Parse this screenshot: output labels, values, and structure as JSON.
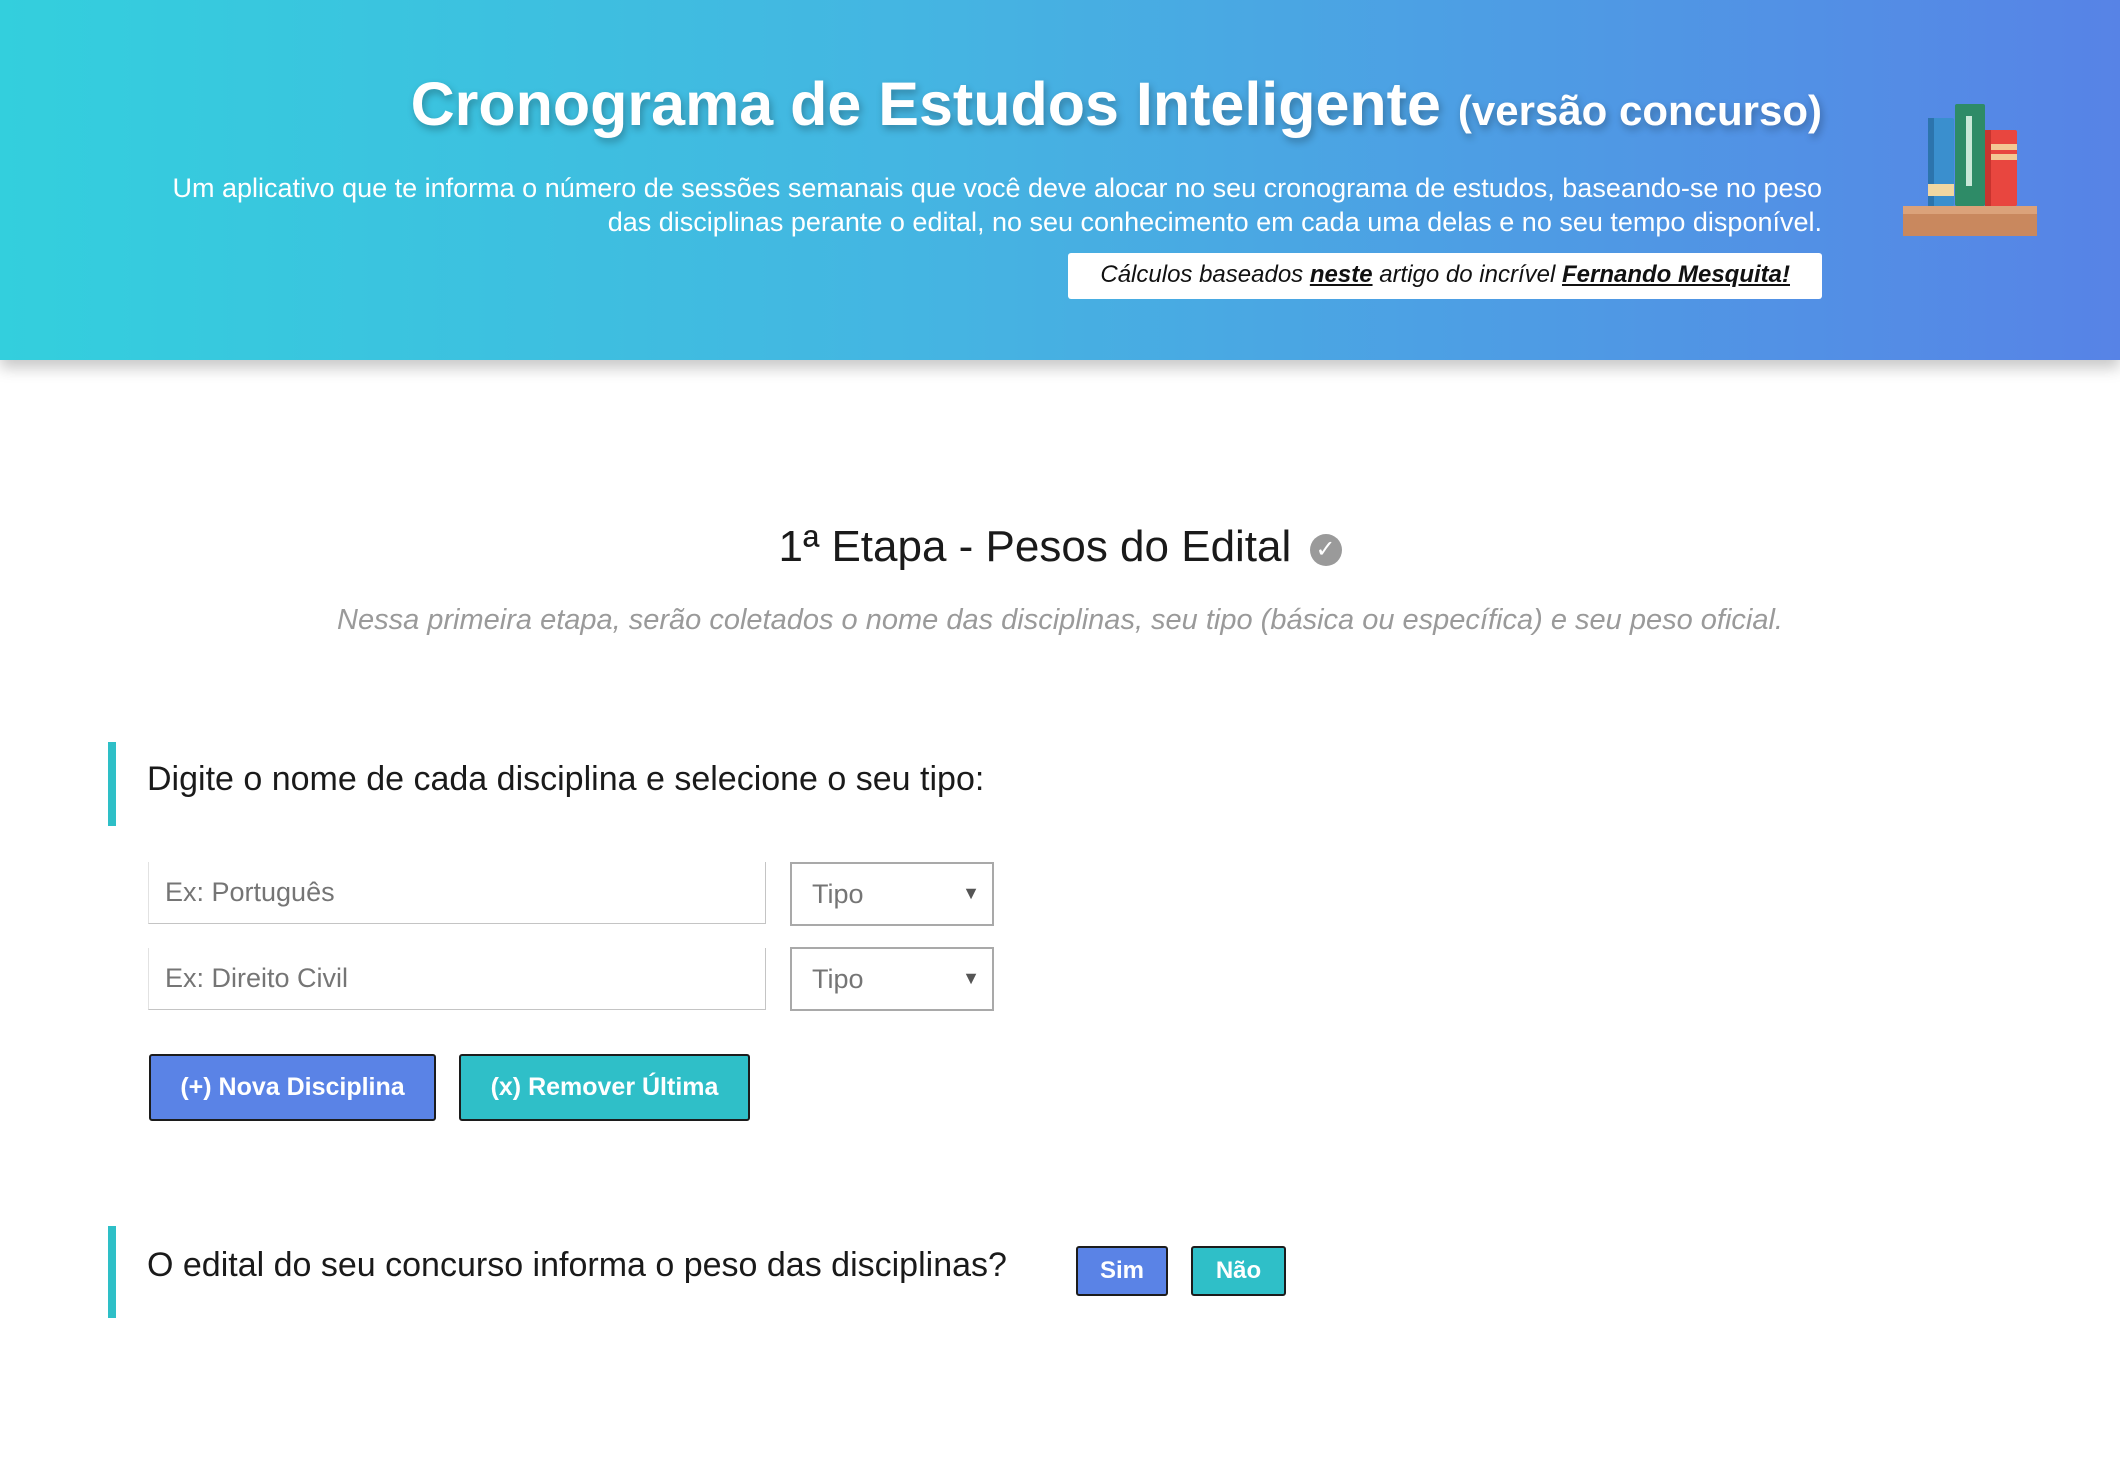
{
  "header": {
    "title": "Cronograma de Estudos Inteligente",
    "title_suffix": "(versão concurso)",
    "description": "Um aplicativo que te informa o número de sessões semanais que você deve alocar no seu cronograma de estudos, baseando-se no peso das disciplinas perante o edital, no seu conhecimento em cada uma delas e no seu tempo disponível.",
    "credits": {
      "prefix": "Cálculos baseados",
      "link1": "neste",
      "middle": "artigo do incrível",
      "link2": "Fernando Mesquita!"
    },
    "logo_icon": "books-icon"
  },
  "stage": {
    "title": "1ª Etapa - Pesos do Edital",
    "status_icon": "check-circle-icon",
    "description": "Nessa primeira etapa, serão coletados o nome das disciplinas, seu tipo (básica ou específica) e seu peso oficial."
  },
  "disciplines": {
    "prompt": "Digite o nome de cada disciplina e selecione o seu tipo:",
    "rows": [
      {
        "name_placeholder": "Ex: Português",
        "type_value": "Tipo"
      },
      {
        "name_placeholder": "Ex: Direito Civil",
        "type_value": "Tipo"
      }
    ],
    "add_button": "(+) Nova Disciplina",
    "remove_button": "(x) Remover Última"
  },
  "weights_question": {
    "prompt": "O edital do seu concurso informa o peso das disciplinas?",
    "yes_button": "Sim",
    "no_button": "Não"
  },
  "colors": {
    "header_gradient_start": "#33cfdd",
    "header_gradient_end": "#5783e6",
    "primary_blue": "#5a83e6",
    "accent_teal": "#2fbfc8"
  }
}
